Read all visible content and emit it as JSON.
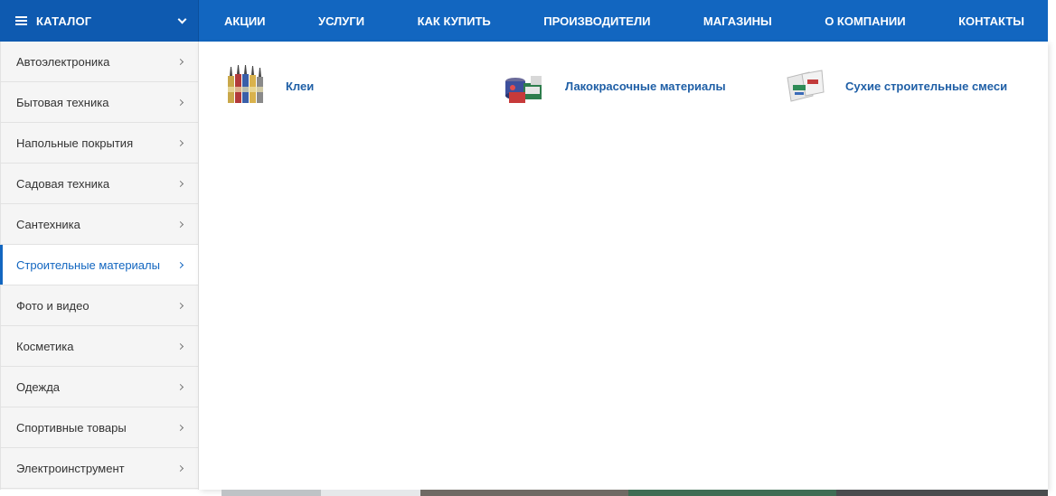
{
  "header": {
    "catalog_label": "КАТАЛОГ",
    "nav": [
      "АКЦИИ",
      "УСЛУГИ",
      "КАК КУПИТЬ",
      "ПРОИЗВОДИТЕЛИ",
      "МАГАЗИНЫ",
      "О КОМПАНИИ",
      "КОНТАКТЫ"
    ]
  },
  "sidebar": {
    "items": [
      {
        "label": "Автоэлектроника"
      },
      {
        "label": "Бытовая техника"
      },
      {
        "label": "Напольные покрытия"
      },
      {
        "label": "Садовая техника"
      },
      {
        "label": "Сантехника"
      },
      {
        "label": "Строительные материалы",
        "active": true
      },
      {
        "label": "Фото и видео"
      },
      {
        "label": "Косметика"
      },
      {
        "label": "Одежда"
      },
      {
        "label": "Спортивные товары"
      },
      {
        "label": "Электроинструмент"
      }
    ]
  },
  "submenu": {
    "items": [
      {
        "label": "Клеи",
        "icon": "glue-tubes-icon"
      },
      {
        "label": "Лакокрасочные материалы",
        "icon": "paint-cans-icon"
      },
      {
        "label": "Сухие строительные смеси",
        "icon": "dry-mix-bags-icon"
      }
    ]
  },
  "colors": {
    "accent": "#1266c0",
    "link": "#1f5fa6"
  }
}
